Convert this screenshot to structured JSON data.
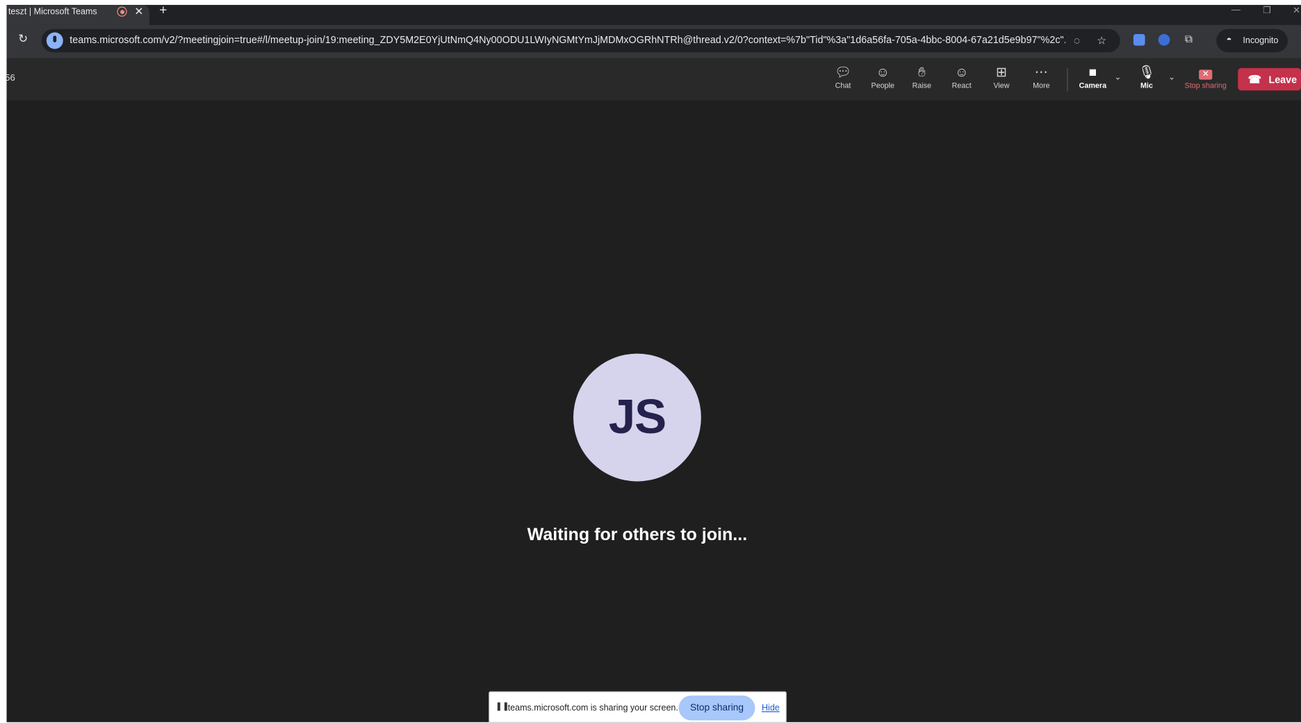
{
  "browser": {
    "tab_title": "teszt | Microsoft Teams",
    "tab_close": "✕",
    "new_tab": "+",
    "url": "teams.microsoft.com/v2/?meetingjoin=true#/l/meetup-join/19:meeting_ZDY5M2E0YjUtNmQ4Ny00ODU1LWIyNGMtYmJjMDMxOGRhNTRh@thread.v2/0?context=%7b\"Tid\"%3a\"1d6a56fa-705a-4bbc-8004-67a21d5e9b97\"%2c\"...",
    "incognito_label": "Incognito"
  },
  "meeting": {
    "timer": "56",
    "controls": {
      "chat": "Chat",
      "people": "People",
      "raise": "Raise",
      "react": "React",
      "view": "View",
      "more": "More",
      "camera": "Camera",
      "mic": "Mic",
      "stop_sharing": "Stop sharing",
      "leave": "Leave"
    },
    "avatar_initials": "JS",
    "status": "Waiting for others to join..."
  },
  "share_banner": {
    "text": "teams.microsoft.com is sharing your screen.",
    "stop_button": "Stop sharing",
    "hide_link": "Hide"
  },
  "colors": {
    "leave": "#c4314b",
    "avatar_bg": "#d6d3ec",
    "stop_sharing_red": "#e06c75",
    "stop_button": "#a8c7fa"
  }
}
